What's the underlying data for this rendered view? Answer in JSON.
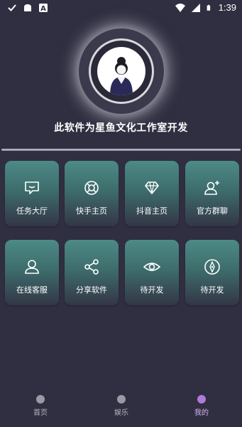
{
  "status_bar": {
    "time": "1:39",
    "icons": [
      "check-icon",
      "android-icon",
      "a-badge-icon",
      "wifi-icon",
      "signal-icon",
      "battery-icon"
    ]
  },
  "profile": {
    "avatar": "avatar-silhouette",
    "subtitle": "此软件为星鱼文化工作室开发"
  },
  "tiles": [
    {
      "label": "任务大厅",
      "icon": "chat-box-icon"
    },
    {
      "label": "快手主页",
      "icon": "lifebuoy-icon"
    },
    {
      "label": "抖音主页",
      "icon": "diamond-icon"
    },
    {
      "label": "官方群聊",
      "icon": "add-user-icon"
    },
    {
      "label": "在线客服",
      "icon": "user-icon"
    },
    {
      "label": "分享软件",
      "icon": "share-icon"
    },
    {
      "label": "待开发",
      "icon": "eye-icon"
    },
    {
      "label": "待开发",
      "icon": "compass-icon"
    }
  ],
  "bottom_nav": {
    "items": [
      {
        "label": "首页",
        "icon": "home-icon",
        "active": false
      },
      {
        "label": "娱乐",
        "icon": "entertainment-icon",
        "active": false
      },
      {
        "label": "我的",
        "icon": "profile-icon",
        "active": true
      }
    ]
  },
  "colors": {
    "background": "#302f41",
    "tile_top": "#4d8a86",
    "tile_bottom": "#333646",
    "active_nav": "#b07ad8"
  }
}
